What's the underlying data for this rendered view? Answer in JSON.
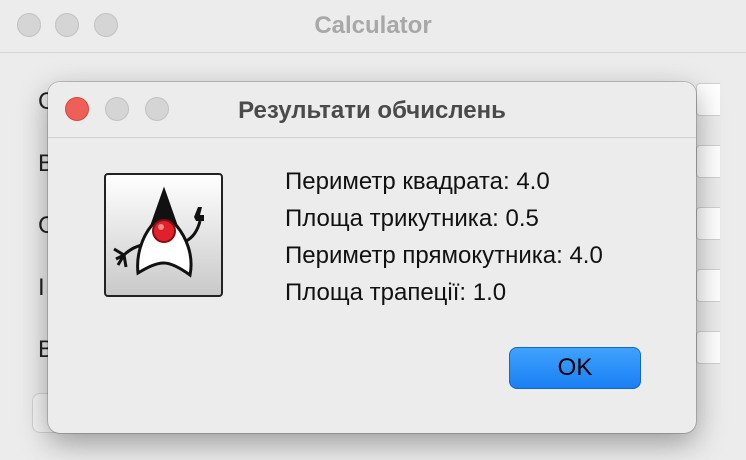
{
  "main_window": {
    "title": "Calculator",
    "row_letters": [
      "C",
      "B",
      "C",
      "I",
      "B"
    ]
  },
  "dialog": {
    "title": "Результати обчислень",
    "icon": "java-duke-icon",
    "results": [
      "Периметр квадрата: 4.0",
      "Площа трикутника: 0.5",
      "Периметр прямокутника: 4.0",
      "Площа трапеції: 1.0"
    ],
    "ok_label": "OK"
  },
  "colors": {
    "close_button": "#ee5f57",
    "inactive_button": "#d5d5d5",
    "accent_button": "#1a7ff2"
  }
}
